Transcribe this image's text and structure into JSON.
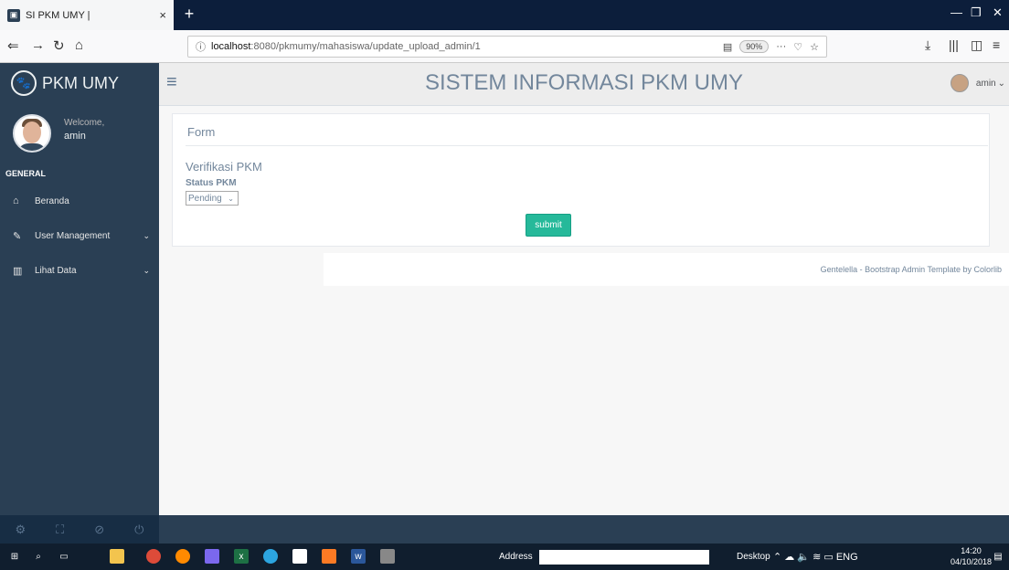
{
  "browser": {
    "tab_title": "SI PKM UMY |",
    "tab_close": "×",
    "new_tab": "+",
    "url_host": "localhost",
    "url_path": ":8080/pkmumy/mahasiswa/update_upload_admin/1",
    "zoom": "90%"
  },
  "sidebar": {
    "brand": "PKM UMY",
    "welcome": "Welcome,",
    "username": "amin",
    "section": "GENERAL",
    "items": [
      {
        "label": "Beranda",
        "icon": "home-icon"
      },
      {
        "label": "User Management",
        "icon": "edit-icon"
      },
      {
        "label": "Lihat Data",
        "icon": "bar-chart-icon"
      }
    ]
  },
  "topnav": {
    "title": "SISTEM INFORMASI PKM UMY",
    "user": "amin"
  },
  "panel": {
    "title": "Form",
    "heading": "Verifikasi PKM",
    "status_label": "Status PKM",
    "status_value": "Pending",
    "submit_label": "submit"
  },
  "footer": {
    "text": "Gentelella - Bootstrap Admin Template by Colorlib"
  },
  "taskbar": {
    "address_label": "Address",
    "desktop_label": "Desktop",
    "lang": "ENG",
    "time": "14:20",
    "date": "04/10/2018"
  },
  "colors": {
    "sidebar": "#2a3f54",
    "accent": "#26b99a",
    "text_muted": "#73879c"
  }
}
